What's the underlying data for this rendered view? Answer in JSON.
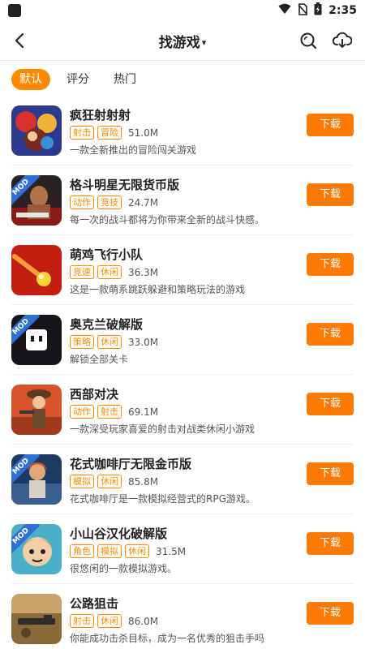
{
  "status_bar": {
    "time": "2:35",
    "icons": [
      "app-notification-icon",
      "wifi-icon",
      "no-sim-icon",
      "battery-icon"
    ]
  },
  "header": {
    "title": "找游戏",
    "caret": "▾",
    "icons": [
      "back-arrow-icon",
      "search-icon",
      "download-icon"
    ]
  },
  "sort_tabs": [
    {
      "label": "默认",
      "active": true
    },
    {
      "label": "评分",
      "active": false
    },
    {
      "label": "热门",
      "active": false
    }
  ],
  "colors": {
    "accent": "#ff8a00",
    "button": "#ff7a00",
    "mod_badge": "#2f6fd6"
  },
  "games": [
    {
      "name": "疯狂射射射",
      "tags": [
        "射击",
        "冒险"
      ],
      "size": "51.0M",
      "desc": "一款全新推出的冒险闯关游戏",
      "button": "下载",
      "mod": false
    },
    {
      "name": "格斗明星无限货币版",
      "tags": [
        "动作",
        "竞技"
      ],
      "size": "24.7M",
      "desc": "每一次的战斗都将为你带来全新的战斗快感。",
      "button": "下载",
      "mod": true
    },
    {
      "name": "萌鸡飞行小队",
      "tags": [
        "竞速",
        "休闲"
      ],
      "size": "36.3M",
      "desc": "这是一款萌系跳跃躲避和策略玩法的游戏",
      "button": "下载",
      "mod": false
    },
    {
      "name": "奥克兰破解版",
      "tags": [
        "策略",
        "休闲"
      ],
      "size": "33.0M",
      "desc": "解锁全部关卡",
      "button": "下载",
      "mod": true
    },
    {
      "name": "西部对决",
      "tags": [
        "动作",
        "射击"
      ],
      "size": "69.1M",
      "desc": "一款深受玩家喜爱的射击对战类休闲小游戏",
      "button": "下载",
      "mod": false
    },
    {
      "name": "花式咖啡厅无限金币版",
      "tags": [
        "模拟",
        "休闲"
      ],
      "size": "85.8M",
      "desc": "花式咖啡厅是一款模拟经营式的RPG游戏。",
      "button": "下载",
      "mod": true
    },
    {
      "name": "小山谷汉化破解版",
      "tags": [
        "角色",
        "模拟",
        "休闲"
      ],
      "size": "31.5M",
      "desc": "很悠闲的一款模拟游戏。",
      "button": "下载",
      "mod": true
    },
    {
      "name": "公路狙击",
      "tags": [
        "射击",
        "休闲"
      ],
      "size": "86.0M",
      "desc": "你能成功击杀目标，成为一名优秀的狙击手吗",
      "button": "下载",
      "mod": false
    }
  ]
}
